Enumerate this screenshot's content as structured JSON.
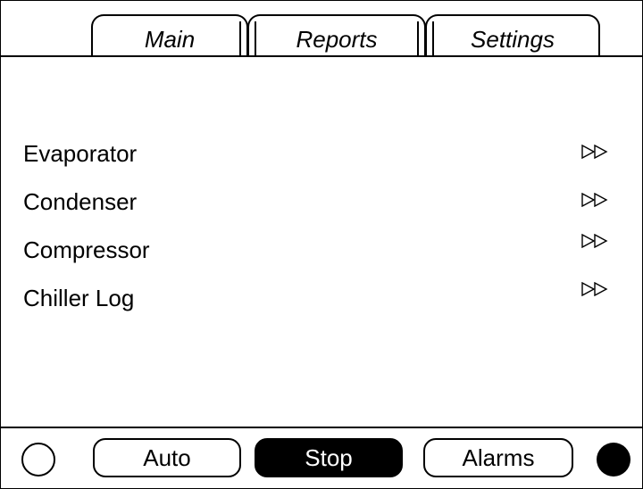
{
  "tabs": [
    {
      "label": "Main"
    },
    {
      "label": "Reports",
      "active": true
    },
    {
      "label": "Settings"
    }
  ],
  "menu": {
    "items": [
      {
        "label": "Evaporator",
        "icon": "double-arrow-right-icon"
      },
      {
        "label": "Condenser",
        "icon": "double-arrow-right-icon"
      },
      {
        "label": "Compressor",
        "icon": "double-arrow-right-icon"
      },
      {
        "label": "Chiller Log",
        "icon": "double-arrow-right-icon"
      }
    ]
  },
  "bottom_bar": {
    "auto_label": "Auto",
    "stop_label": "Stop",
    "alarms_label": "Alarms",
    "left_indicator": "status-indicator-off",
    "right_indicator": "status-indicator-on"
  },
  "colors": {
    "foreground": "#000000",
    "background": "#ffffff"
  }
}
